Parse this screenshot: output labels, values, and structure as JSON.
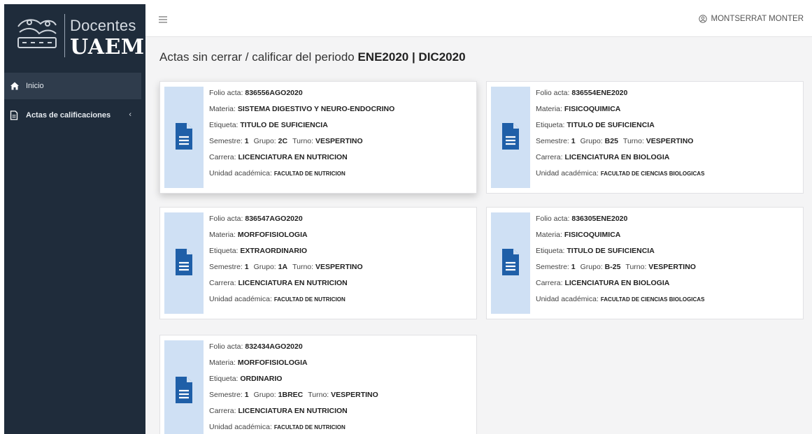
{
  "brand": {
    "top": "Docentes",
    "bottom": "UAEM"
  },
  "sidebar": {
    "items": [
      {
        "label": "Inicio",
        "icon": "home-icon",
        "active": true
      },
      {
        "label": "Actas de calificaciones",
        "icon": "document-icon",
        "chevron": "‹"
      }
    ]
  },
  "topbar": {
    "menu_icon": "hamburger-icon",
    "user_name": "MONTSERRAT MONTER",
    "user_icon": "user-circle-icon"
  },
  "page": {
    "title_prefix": "Actas sin cerrar / calificar del periodo ",
    "period": "ENE2020 | DIC2020"
  },
  "labels": {
    "folio": "Folio acta: ",
    "materia": "Materia: ",
    "etiqueta": "Etiqueta: ",
    "semestre": "Semestre: ",
    "grupo": "Grupo: ",
    "turno": "Turno: ",
    "carrera": "Carrera: ",
    "unidad": "Unidad académica: "
  },
  "cards": [
    {
      "folio": "836556AGO2020",
      "materia": "SISTEMA DIGESTIVO Y NEURO-ENDOCRINO",
      "etiqueta": "TITULO DE SUFICIENCIA",
      "semestre": "1",
      "grupo": "2C",
      "turno": "VESPERTINO",
      "carrera": "LICENCIATURA EN NUTRICION",
      "unidad": "FACULTAD DE NUTRICION"
    },
    {
      "folio": "836554ENE2020",
      "materia": "FISICOQUIMICA",
      "etiqueta": "TITULO DE SUFICIENCIA",
      "semestre": "1",
      "grupo": "B25",
      "turno": "VESPERTINO",
      "carrera": "LICENCIATURA EN BIOLOGIA",
      "unidad": "FACULTAD DE CIENCIAS BIOLOGICAS"
    },
    {
      "folio": "836547AGO2020",
      "materia": "MORFOFISIOLOGIA",
      "etiqueta": "EXTRAORDINARIO",
      "semestre": "1",
      "grupo": "1A",
      "turno": "VESPERTINO",
      "carrera": "LICENCIATURA EN NUTRICION",
      "unidad": "FACULTAD DE NUTRICION"
    },
    {
      "folio": "836305ENE2020",
      "materia": "FISICOQUIMICA",
      "etiqueta": "TITULO DE SUFICIENCIA",
      "semestre": "1",
      "grupo": "B-25",
      "turno": "VESPERTINO",
      "carrera": "LICENCIATURA EN BIOLOGIA",
      "unidad": "FACULTAD DE CIENCIAS BIOLOGICAS"
    },
    {
      "folio": "832434AGO2020",
      "materia": "MORFOFISIOLOGIA",
      "etiqueta": "ORDINARIO",
      "semestre": "1",
      "grupo": "1BREC",
      "turno": "VESPERTINO",
      "carrera": "LICENCIATURA EN NUTRICION",
      "unidad": "FACULTAD DE NUTRICION"
    }
  ],
  "colors": {
    "sidebar": "#1f2c3b",
    "sidebar_active": "#2f3c4c",
    "icon_blue": "#1f5fa8",
    "card_side": "#cfe0f4"
  }
}
